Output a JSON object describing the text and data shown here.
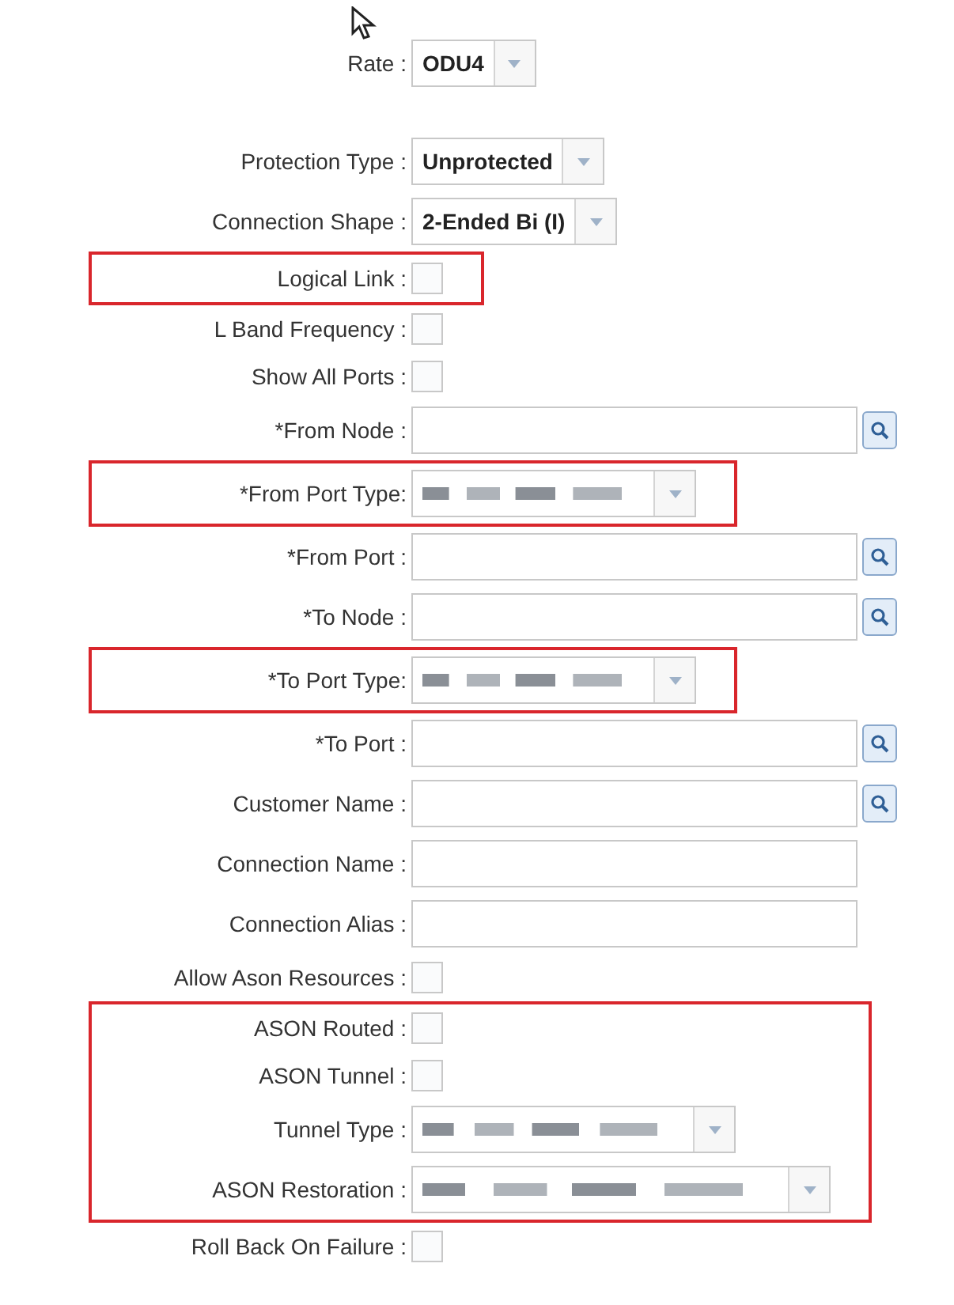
{
  "sections": [
    {
      "highlighted": false,
      "rows": [
        {
          "label": "Rate :",
          "kind": "select",
          "value": "ODU4"
        }
      ]
    },
    {
      "highlighted": false,
      "rows": [
        {
          "label": "Protection Type :",
          "kind": "select",
          "value": "Unprotected"
        },
        {
          "label": "Connection Shape :",
          "kind": "select",
          "value": "2-Ended Bi (I)"
        }
      ]
    },
    {
      "highlighted": true,
      "rows": [
        {
          "label": "Logical Link :",
          "kind": "checkbox",
          "checked": false
        }
      ]
    },
    {
      "highlighted": false,
      "rows": [
        {
          "label": "L Band Frequency :",
          "kind": "checkbox",
          "checked": false
        },
        {
          "label": "Show All Ports :",
          "kind": "checkbox",
          "checked": false
        },
        {
          "label": "*From Node :",
          "kind": "lookup"
        }
      ]
    },
    {
      "highlighted": true,
      "rows": [
        {
          "label": "*From Port Type:",
          "kind": "select",
          "redacted": true
        }
      ]
    },
    {
      "highlighted": false,
      "rows": [
        {
          "label": "*From Port :",
          "kind": "lookup"
        },
        {
          "label": "*To Node :",
          "kind": "lookup"
        }
      ]
    },
    {
      "highlighted": true,
      "rows": [
        {
          "label": "*To Port Type:",
          "kind": "select",
          "redacted": true
        }
      ]
    },
    {
      "highlighted": false,
      "rows": [
        {
          "label": "*To Port :",
          "kind": "lookup"
        },
        {
          "label": "Customer Name :",
          "kind": "lookup"
        },
        {
          "label": "Connection Name :",
          "kind": "text"
        },
        {
          "label": "Connection Alias :",
          "kind": "text"
        },
        {
          "label": "Allow Ason Resources :",
          "kind": "checkbox",
          "checked": false
        }
      ]
    },
    {
      "highlighted": true,
      "rows": [
        {
          "label": "ASON Routed :",
          "kind": "checkbox",
          "checked": false
        },
        {
          "label": "ASON Tunnel :",
          "kind": "checkbox",
          "checked": false
        },
        {
          "label": "Tunnel Type :",
          "kind": "select",
          "redacted": true
        },
        {
          "label": "ASON Restoration :",
          "kind": "select",
          "redacted": true
        }
      ]
    },
    {
      "highlighted": false,
      "rows": [
        {
          "label": "Roll Back On Failure :",
          "kind": "checkbox",
          "checked": false
        }
      ]
    }
  ]
}
